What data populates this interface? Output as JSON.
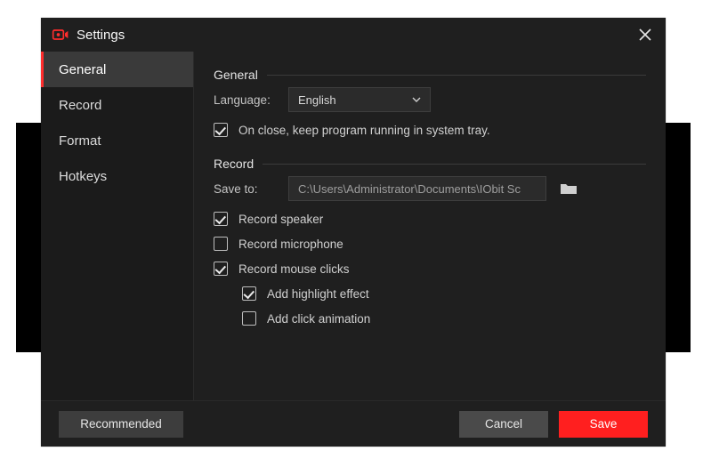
{
  "title": "Settings",
  "sidebar": {
    "items": [
      {
        "label": "General"
      },
      {
        "label": "Record"
      },
      {
        "label": "Format"
      },
      {
        "label": "Hotkeys"
      }
    ]
  },
  "general": {
    "heading": "General",
    "language_label": "Language:",
    "language_value": "English",
    "keep_running_label": "On close, keep program running in system tray."
  },
  "record": {
    "heading": "Record",
    "save_to_label": "Save to:",
    "save_to_path": "C:\\Users\\Administrator\\Documents\\IObit Sc",
    "record_speaker": "Record speaker",
    "record_microphone": "Record microphone",
    "record_mouse": "Record mouse clicks",
    "highlight_effect": "Add highlight effect",
    "click_animation": "Add click animation"
  },
  "footer": {
    "recommended": "Recommended",
    "cancel": "Cancel",
    "save": "Save"
  }
}
